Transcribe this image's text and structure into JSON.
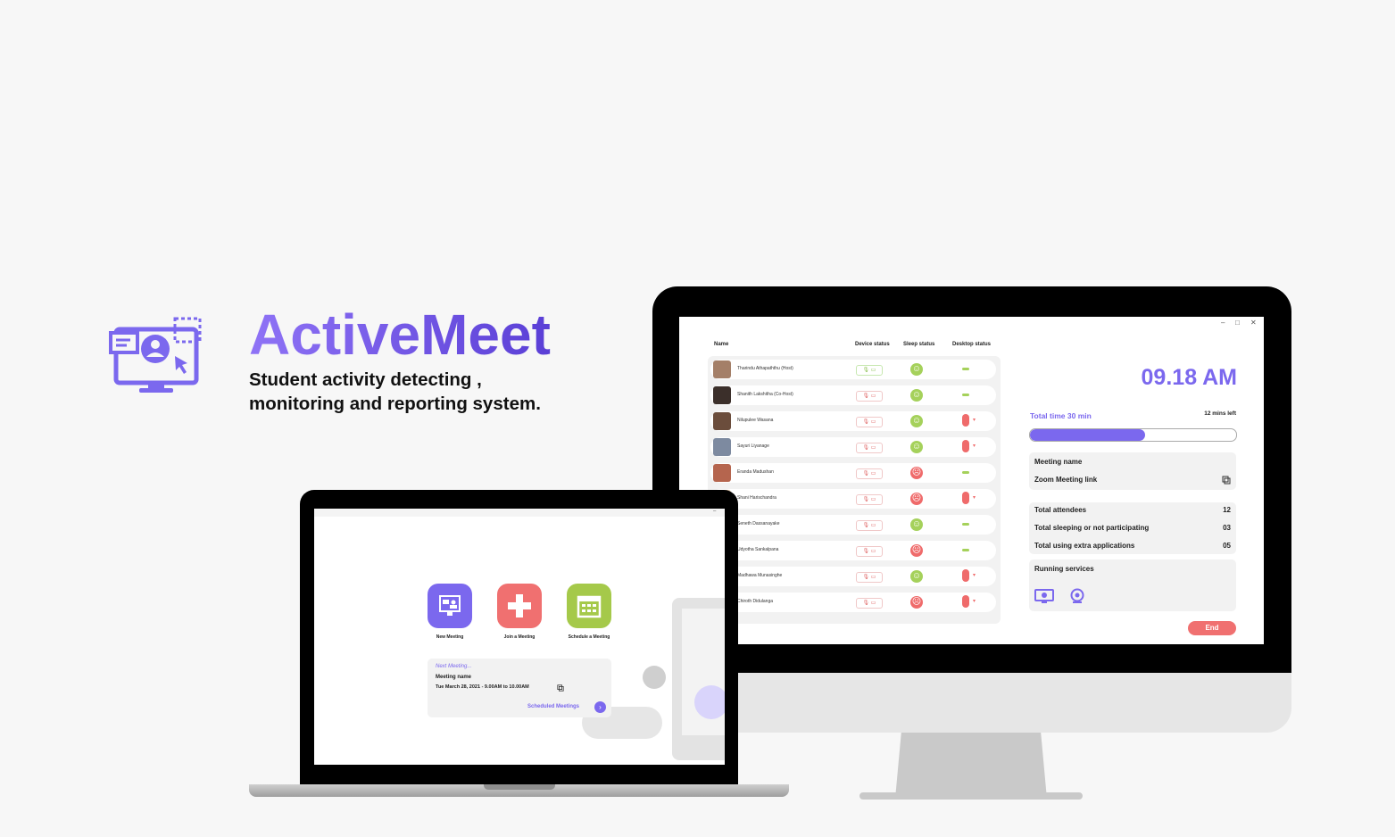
{
  "brand": {
    "title": "ActiveMeet",
    "subtitle_line1": "Student activity detecting ,",
    "subtitle_line2": "monitoring and reporting system.",
    "accent_color": "#7b68ee",
    "logo_icon": "monitor-user-cursor-icon"
  },
  "desktop_app": {
    "window_controls": [
      "–",
      "□",
      "✕"
    ],
    "columns": {
      "name": "Name",
      "device": "Device status",
      "sleep": "Sleep status",
      "desktop": "Desktop status"
    },
    "attendees": [
      {
        "name": "Tharindu Athapaththu (Host)",
        "device": "ok",
        "sleep": "happy",
        "desktop": "idle"
      },
      {
        "name": "Shanith Lakshitha (Co-Host)",
        "device": "off",
        "sleep": "happy",
        "desktop": "idle"
      },
      {
        "name": "Nilupulee Wasana",
        "device": "off",
        "sleep": "happy",
        "desktop": "mouse"
      },
      {
        "name": "Sayuri Liyanage",
        "device": "off",
        "sleep": "happy",
        "desktop": "mouse"
      },
      {
        "name": "Eranda Madushan",
        "device": "off",
        "sleep": "sad",
        "desktop": "idle"
      },
      {
        "name": "Shani Harischandra",
        "device": "off",
        "sleep": "sad",
        "desktop": "mouse"
      },
      {
        "name": "Seneth Dassanayake",
        "device": "off",
        "sleep": "happy",
        "desktop": "idle"
      },
      {
        "name": "Udyotha Sankalpana",
        "device": "off",
        "sleep": "sad",
        "desktop": "idle"
      },
      {
        "name": "Madhawa Munasinghe",
        "device": "off",
        "sleep": "happy",
        "desktop": "mouse"
      },
      {
        "name": "Chiroth Didulanga",
        "device": "off",
        "sleep": "sad",
        "desktop": "mouse"
      }
    ],
    "clock": "09.18 AM",
    "total_time": "Total time 30 min",
    "time_left": "12 mins left",
    "progress": 0.56,
    "meeting_name_label": "Meeting name",
    "zoom_link_label": "Zoom Meeting link",
    "stats": [
      {
        "label": "Total attendees",
        "value": "12"
      },
      {
        "label": "Total sleeping or not participating",
        "value": "03"
      },
      {
        "label": "Total using extra applications",
        "value": "05"
      }
    ],
    "running_services_label": "Running services",
    "services_icons": [
      "screen-monitor-icon",
      "webcam-icon"
    ],
    "end_button": "End"
  },
  "laptop_app": {
    "actions": [
      {
        "label": "New Meeting",
        "color": "#7b68ee",
        "icon": "video-meeting-icon"
      },
      {
        "label": "Join a Meeting",
        "color": "#f07070",
        "icon": "plus-icon"
      },
      {
        "label": "Schedule a Meeting",
        "color": "#a5c94a",
        "icon": "calendar-icon"
      }
    ],
    "next_meeting_label": "Next Meeting...",
    "meeting_name": "Meeting name",
    "meeting_time": "Tue March 28, 2021 - 9.00AM to 10.00AM",
    "scheduled_link": "Scheduled Meetings"
  }
}
